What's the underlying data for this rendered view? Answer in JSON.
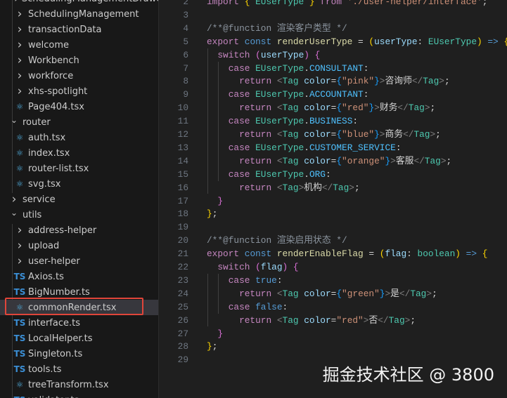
{
  "explorer": {
    "items": [
      {
        "label": "SchedulingManagementDrawer",
        "type": "folder",
        "depth": 2
      },
      {
        "label": "SchedulingManagement",
        "type": "folder",
        "depth": 2
      },
      {
        "label": "transactionData",
        "type": "folder",
        "depth": 2
      },
      {
        "label": "welcome",
        "type": "folder",
        "depth": 2
      },
      {
        "label": "Workbench",
        "type": "folder",
        "depth": 2
      },
      {
        "label": "workforce",
        "type": "folder",
        "depth": 2
      },
      {
        "label": "xhs-spotlight",
        "type": "folder",
        "depth": 2
      },
      {
        "label": "Page404.tsx",
        "type": "react",
        "depth": 2
      },
      {
        "label": "router",
        "type": "open-folder",
        "depth": 1
      },
      {
        "label": "auth.tsx",
        "type": "react",
        "depth": 2
      },
      {
        "label": "index.tsx",
        "type": "react",
        "depth": 2
      },
      {
        "label": "router-list.tsx",
        "type": "react",
        "depth": 2
      },
      {
        "label": "svg.tsx",
        "type": "react",
        "depth": 2
      },
      {
        "label": "service",
        "type": "folder",
        "depth": 1
      },
      {
        "label": "utils",
        "type": "open-folder",
        "depth": 1
      },
      {
        "label": "address-helper",
        "type": "folder",
        "depth": 2
      },
      {
        "label": "upload",
        "type": "folder",
        "depth": 2
      },
      {
        "label": "user-helper",
        "type": "folder",
        "depth": 2
      },
      {
        "label": "Axios.ts",
        "type": "ts",
        "depth": 2
      },
      {
        "label": "BigNumber.ts",
        "type": "ts",
        "depth": 2
      },
      {
        "label": "commonRender.tsx",
        "type": "react",
        "depth": 2,
        "selected": true
      },
      {
        "label": "interface.ts",
        "type": "ts",
        "depth": 2
      },
      {
        "label": "LocalHelper.ts",
        "type": "ts",
        "depth": 2
      },
      {
        "label": "Singleton.ts",
        "type": "ts",
        "depth": 2
      },
      {
        "label": "tools.ts",
        "type": "ts",
        "depth": 2
      },
      {
        "label": "treeTransform.tsx",
        "type": "react",
        "depth": 2
      },
      {
        "label": "validator.ts",
        "type": "ts",
        "depth": 2
      }
    ]
  },
  "editor": {
    "first_line": 2,
    "lines": [
      [
        [
          "import ",
          "kw"
        ],
        [
          "{ ",
          "b1"
        ],
        [
          "EUserType ",
          "ty"
        ],
        [
          "} ",
          "b1"
        ],
        [
          "from ",
          "kw"
        ],
        [
          "'./user-helper/interface'",
          "str"
        ],
        [
          ";",
          "tx"
        ]
      ],
      [],
      [
        [
          "/**@function 渲染客户类型 */",
          "cm"
        ]
      ],
      [
        [
          "export ",
          "kw"
        ],
        [
          "const ",
          "st"
        ],
        [
          "renderUserType ",
          "fn"
        ],
        [
          "= ",
          "tx"
        ],
        [
          "(",
          "b1"
        ],
        [
          "userType",
          "id"
        ],
        [
          ": ",
          "tx"
        ],
        [
          "EUserType",
          "ty"
        ],
        [
          ") ",
          "b1"
        ],
        [
          "=> ",
          "st"
        ],
        [
          "{",
          "b1"
        ]
      ],
      [
        [
          "  switch ",
          "kw"
        ],
        [
          "(",
          "b2"
        ],
        [
          "userType",
          "id"
        ],
        [
          ") ",
          "b2"
        ],
        [
          "{",
          "b2"
        ]
      ],
      [
        [
          "    case ",
          "kw"
        ],
        [
          "EUserType",
          "ty"
        ],
        [
          ".",
          "tx"
        ],
        [
          "CONSULTANT",
          "en"
        ],
        [
          ":",
          "tx"
        ]
      ],
      [
        [
          "      return ",
          "kw"
        ],
        [
          "<",
          "pu"
        ],
        [
          "Tag ",
          "ty"
        ],
        [
          "color",
          "id"
        ],
        [
          "=",
          "tx"
        ],
        [
          "{",
          "b3"
        ],
        [
          "\"pink\"",
          "str"
        ],
        [
          "}",
          "b3"
        ],
        [
          ">",
          "pu"
        ],
        [
          "咨询师",
          "tx"
        ],
        [
          "</",
          "pu"
        ],
        [
          "Tag",
          "ty"
        ],
        [
          ">",
          "pu"
        ],
        [
          ";",
          "tx"
        ]
      ],
      [
        [
          "    case ",
          "kw"
        ],
        [
          "EUserType",
          "ty"
        ],
        [
          ".",
          "tx"
        ],
        [
          "ACCOUNTANT",
          "en"
        ],
        [
          ":",
          "tx"
        ]
      ],
      [
        [
          "      return ",
          "kw"
        ],
        [
          "<",
          "pu"
        ],
        [
          "Tag ",
          "ty"
        ],
        [
          "color",
          "id"
        ],
        [
          "=",
          "tx"
        ],
        [
          "{",
          "b3"
        ],
        [
          "\"red\"",
          "str"
        ],
        [
          "}",
          "b3"
        ],
        [
          ">",
          "pu"
        ],
        [
          "财务",
          "tx"
        ],
        [
          "</",
          "pu"
        ],
        [
          "Tag",
          "ty"
        ],
        [
          ">",
          "pu"
        ],
        [
          ";",
          "tx"
        ]
      ],
      [
        [
          "    case ",
          "kw"
        ],
        [
          "EUserType",
          "ty"
        ],
        [
          ".",
          "tx"
        ],
        [
          "BUSINESS",
          "en"
        ],
        [
          ":",
          "tx"
        ]
      ],
      [
        [
          "      return ",
          "kw"
        ],
        [
          "<",
          "pu"
        ],
        [
          "Tag ",
          "ty"
        ],
        [
          "color",
          "id"
        ],
        [
          "=",
          "tx"
        ],
        [
          "{",
          "b3"
        ],
        [
          "\"blue\"",
          "str"
        ],
        [
          "}",
          "b3"
        ],
        [
          ">",
          "pu"
        ],
        [
          "商务",
          "tx"
        ],
        [
          "</",
          "pu"
        ],
        [
          "Tag",
          "ty"
        ],
        [
          ">",
          "pu"
        ],
        [
          ";",
          "tx"
        ]
      ],
      [
        [
          "    case ",
          "kw"
        ],
        [
          "EUserType",
          "ty"
        ],
        [
          ".",
          "tx"
        ],
        [
          "CUSTOMER_SERVICE",
          "en"
        ],
        [
          ":",
          "tx"
        ]
      ],
      [
        [
          "      return ",
          "kw"
        ],
        [
          "<",
          "pu"
        ],
        [
          "Tag ",
          "ty"
        ],
        [
          "color",
          "id"
        ],
        [
          "=",
          "tx"
        ],
        [
          "{",
          "b3"
        ],
        [
          "\"orange\"",
          "str"
        ],
        [
          "}",
          "b3"
        ],
        [
          ">",
          "pu"
        ],
        [
          "客服",
          "tx"
        ],
        [
          "</",
          "pu"
        ],
        [
          "Tag",
          "ty"
        ],
        [
          ">",
          "pu"
        ],
        [
          ";",
          "tx"
        ]
      ],
      [
        [
          "    case ",
          "kw"
        ],
        [
          "EUserType",
          "ty"
        ],
        [
          ".",
          "tx"
        ],
        [
          "ORG",
          "en"
        ],
        [
          ":",
          "tx"
        ]
      ],
      [
        [
          "      return ",
          "kw"
        ],
        [
          "<",
          "pu"
        ],
        [
          "Tag",
          "ty"
        ],
        [
          ">",
          "pu"
        ],
        [
          "机构",
          "tx"
        ],
        [
          "</",
          "pu"
        ],
        [
          "Tag",
          "ty"
        ],
        [
          ">",
          "pu"
        ],
        [
          ";",
          "tx"
        ]
      ],
      [
        [
          "  }",
          "b2"
        ]
      ],
      [
        [
          "}",
          "b1"
        ],
        [
          ";",
          "tx"
        ]
      ],
      [],
      [
        [
          "/**@function 渲染启用状态 */",
          "cm"
        ]
      ],
      [
        [
          "export ",
          "kw"
        ],
        [
          "const ",
          "st"
        ],
        [
          "renderEnableFlag ",
          "fn"
        ],
        [
          "= ",
          "tx"
        ],
        [
          "(",
          "b1"
        ],
        [
          "flag",
          "id"
        ],
        [
          ": ",
          "tx"
        ],
        [
          "boolean",
          "ty"
        ],
        [
          ") ",
          "b1"
        ],
        [
          "=> ",
          "st"
        ],
        [
          "{",
          "b1"
        ]
      ],
      [
        [
          "  switch ",
          "kw"
        ],
        [
          "(",
          "b2"
        ],
        [
          "flag",
          "id"
        ],
        [
          ") ",
          "b2"
        ],
        [
          "{",
          "b2"
        ]
      ],
      [
        [
          "    case ",
          "kw"
        ],
        [
          "true",
          "st"
        ],
        [
          ":",
          "tx"
        ]
      ],
      [
        [
          "      return ",
          "kw"
        ],
        [
          "<",
          "pu"
        ],
        [
          "Tag ",
          "ty"
        ],
        [
          "color",
          "id"
        ],
        [
          "=",
          "tx"
        ],
        [
          "{",
          "b3"
        ],
        [
          "\"green\"",
          "str"
        ],
        [
          "}",
          "b3"
        ],
        [
          ">",
          "pu"
        ],
        [
          "是",
          "tx"
        ],
        [
          "</",
          "pu"
        ],
        [
          "Tag",
          "ty"
        ],
        [
          ">",
          "pu"
        ],
        [
          ";",
          "tx"
        ]
      ],
      [
        [
          "    case ",
          "kw"
        ],
        [
          "false",
          "st"
        ],
        [
          ":",
          "tx"
        ]
      ],
      [
        [
          "      return ",
          "kw"
        ],
        [
          "<",
          "pu"
        ],
        [
          "Tag ",
          "ty"
        ],
        [
          "color",
          "id"
        ],
        [
          "=",
          "tx"
        ],
        [
          "\"red\"",
          "str"
        ],
        [
          ">",
          "pu"
        ],
        [
          "否",
          "tx"
        ],
        [
          "</",
          "pu"
        ],
        [
          "Tag",
          "ty"
        ],
        [
          ">",
          "pu"
        ],
        [
          ";",
          "tx"
        ]
      ],
      [
        [
          "  }",
          "b2"
        ]
      ],
      [
        [
          "}",
          "b1"
        ],
        [
          ";",
          "tx"
        ]
      ],
      []
    ]
  },
  "watermark": "掘金技术社区 @ 3800"
}
